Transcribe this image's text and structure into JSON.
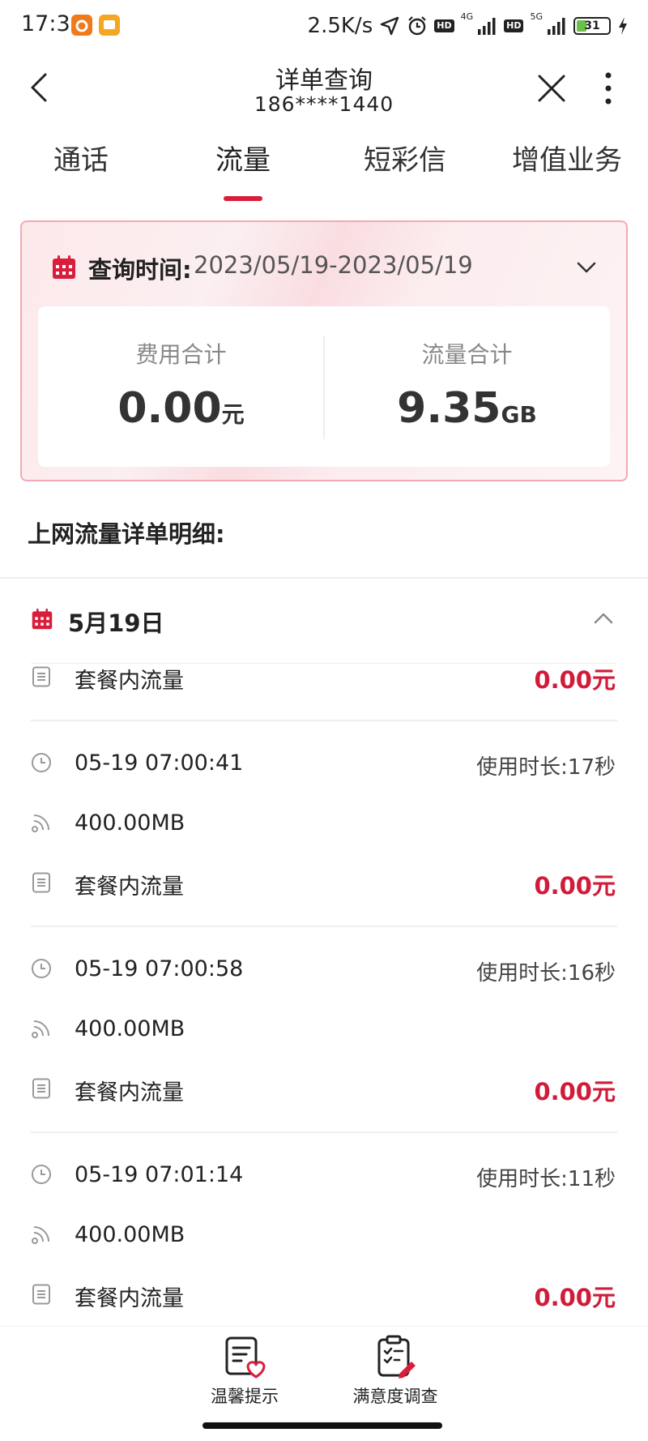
{
  "status_bar": {
    "time": "17:39",
    "net_speed": "2.5K/s",
    "hd1": "HD",
    "net1": "4G",
    "hd2": "HD",
    "net2": "5G",
    "battery": "31",
    "battery_level": 0.31,
    "app_icon_colors": [
      "#f07a1a",
      "#f5a623"
    ]
  },
  "nav": {
    "title": "详单查询",
    "phone": "186****1440"
  },
  "tabs": [
    {
      "label": "通话"
    },
    {
      "label": "流量",
      "active": true
    },
    {
      "label": "短彩信"
    },
    {
      "label": "增值业务"
    }
  ],
  "summary": {
    "query_label": "查询时间:",
    "query_range": "2023/05/19-2023/05/19",
    "cost_label": "费用合计",
    "cost_value": "0.00",
    "cost_unit": "元",
    "data_label": "流量合计",
    "data_value": "9.35",
    "data_unit": "GB"
  },
  "section_title": "上网流量详单明细:",
  "day": {
    "label": "5月19日"
  },
  "partial_record": {
    "type": "套餐内流量",
    "cost": "0.00元"
  },
  "records": [
    {
      "time": "05-19 07:00:41",
      "duration": "使用时长:17秒",
      "amount": "400.00MB",
      "type": "套餐内流量",
      "cost": "0.00元"
    },
    {
      "time": "05-19 07:00:58",
      "duration": "使用时长:16秒",
      "amount": "400.00MB",
      "type": "套餐内流量",
      "cost": "0.00元"
    },
    {
      "time": "05-19 07:01:14",
      "duration": "使用时长:11秒",
      "amount": "400.00MB",
      "type": "套餐内流量",
      "cost": "0.00元"
    }
  ],
  "bottom_bar": {
    "tips": "温馨提示",
    "survey": "满意度调查"
  },
  "colors": {
    "accent": "#d91e3b",
    "cost": "#d01c3a",
    "card_border": "#f4a9b4"
  }
}
